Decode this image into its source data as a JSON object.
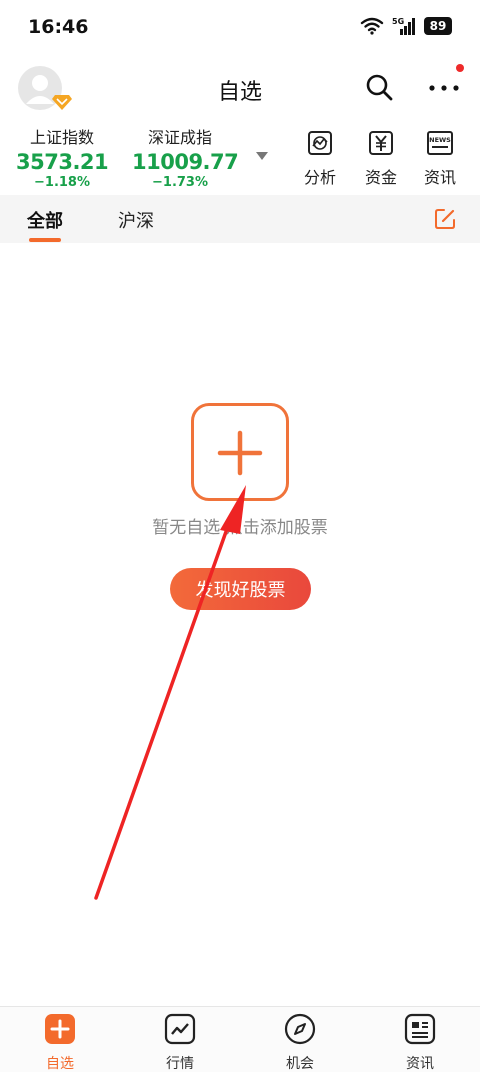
{
  "status_bar": {
    "time": "16:46",
    "network": "5G",
    "battery": "89"
  },
  "header": {
    "title": "自选"
  },
  "indices": [
    {
      "name": "上证指数",
      "value": "3573.21",
      "change": "−1.18%"
    },
    {
      "name": "深证成指",
      "value": "11009.77",
      "change": "−1.73%"
    }
  ],
  "tools": [
    {
      "label": "分析",
      "icon": "analysis-chart-icon"
    },
    {
      "label": "资金",
      "icon": "yen-icon"
    },
    {
      "label": "资讯",
      "icon": "news-icon",
      "icon_text": "NEWS"
    }
  ],
  "tabs": [
    {
      "label": "全部",
      "active": true
    },
    {
      "label": "沪深",
      "active": false
    }
  ],
  "empty_state": {
    "hint": "暂无自选 点击添加股票",
    "discover_label": "发现好股票"
  },
  "bottom_nav": [
    {
      "label": "自选",
      "icon": "plus-square-icon",
      "active": true
    },
    {
      "label": "行情",
      "icon": "trend-line-icon",
      "active": false
    },
    {
      "label": "机会",
      "icon": "compass-icon",
      "active": false
    },
    {
      "label": "资讯",
      "icon": "newspaper-icon",
      "active": false
    }
  ],
  "colors": {
    "accent": "#f36a2c",
    "down": "#18a04a",
    "annotation_arrow": "#ee2424"
  }
}
